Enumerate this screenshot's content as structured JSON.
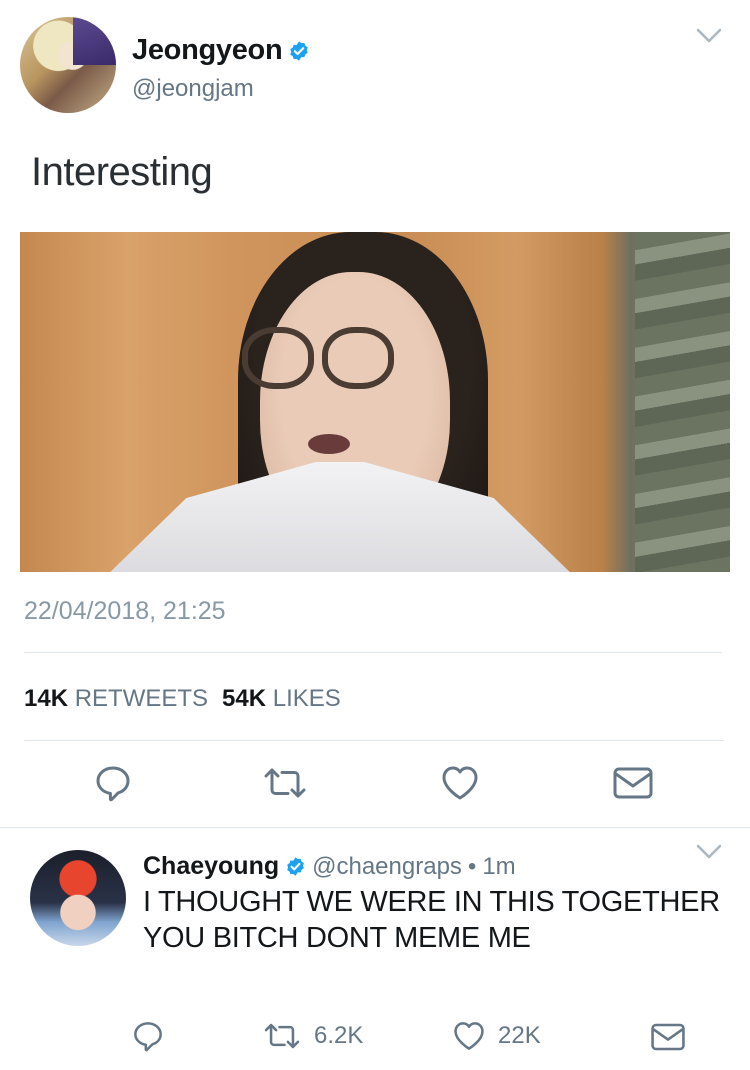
{
  "main_tweet": {
    "display_name": "Jeongyeon",
    "handle": "@jeongjam",
    "verified": true,
    "text": "Interesting",
    "media_description": "photo",
    "timestamp": "22/04/2018, 21:25",
    "retweets_count": "14K",
    "retweets_label": "RETWEETS",
    "likes_count": "54K",
    "likes_label": "LIKES",
    "actions": [
      "reply-icon",
      "retweet-icon",
      "like-icon",
      "message-icon"
    ]
  },
  "reply_tweet": {
    "display_name": "Chaeyoung",
    "verified": true,
    "handle": "@chaengraps",
    "separator": "•",
    "time": "1m",
    "text_line1": "I THOUGHT WE WERE IN THIS TOGETHER",
    "text_line2": "YOU BITCH DONT MEME ME",
    "retweet_count": "6.2K",
    "like_count": "22K"
  },
  "colors": {
    "verified_blue": "#1da1f2",
    "secondary_text": "#657786",
    "icon_gray": "#657786",
    "divider": "#e1e8ed"
  }
}
